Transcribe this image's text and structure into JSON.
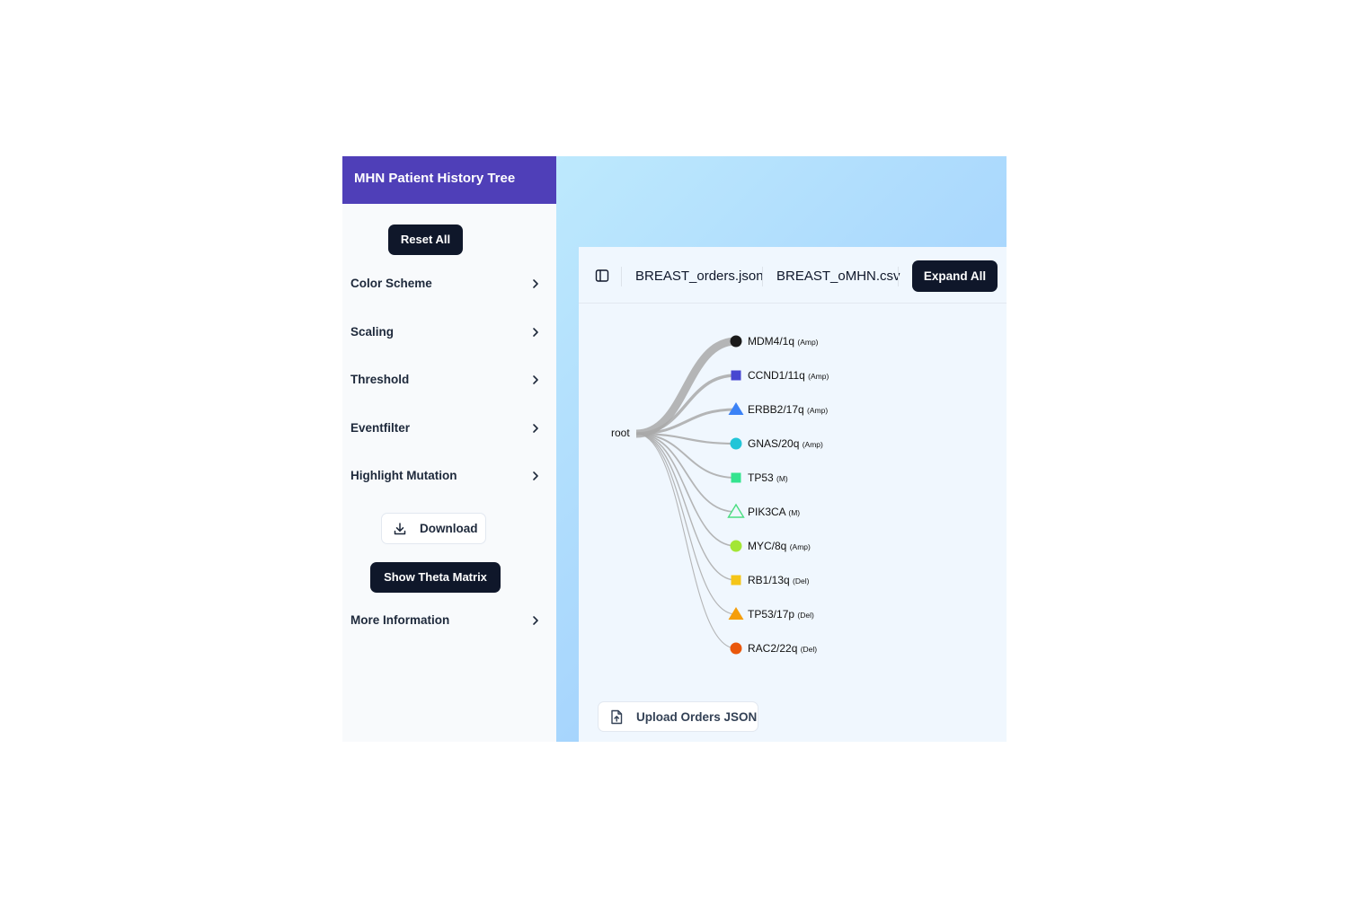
{
  "sidebar": {
    "title": "MHN Patient History Tree",
    "reset_label": "Reset All",
    "accordions": [
      {
        "label": "Color Scheme"
      },
      {
        "label": "Scaling"
      },
      {
        "label": "Threshold"
      },
      {
        "label": "Eventfilter"
      },
      {
        "label": "Highlight Mutation"
      }
    ],
    "download_label": "Download",
    "theta_label": "Show Theta Matrix",
    "more_info_label": "More Information"
  },
  "toolbar": {
    "orders_file": "BREAST_orders.json",
    "omhn_file": "BREAST_oMHN.csv",
    "expand_label": "Expand All"
  },
  "tree": {
    "root_label": "root",
    "link_color": "#a9a9a9",
    "nodes": [
      {
        "label": "MDM4/1q",
        "type": "(Amp)",
        "shape": "circle",
        "color": "#1a1a1a",
        "weight": 9
      },
      {
        "label": "CCND1/11q",
        "type": "(Amp)",
        "shape": "square",
        "color": "#4747d1",
        "weight": 3.5
      },
      {
        "label": "ERBB2/17q",
        "type": "(Amp)",
        "shape": "triangle",
        "color": "#3b82f6",
        "weight": 3
      },
      {
        "label": "GNAS/20q",
        "type": "(Amp)",
        "shape": "circle",
        "color": "#22c5d8",
        "weight": 2.2
      },
      {
        "label": "TP53",
        "type": "(M)",
        "shape": "square",
        "color": "#34e48f",
        "weight": 2
      },
      {
        "label": "PIK3CA",
        "type": "(M)",
        "shape": "triangle-outline",
        "color": "#4ade80",
        "weight": 1.8
      },
      {
        "label": "MYC/8q",
        "type": "(Amp)",
        "shape": "circle",
        "color": "#a3e635",
        "weight": 1.6
      },
      {
        "label": "RB1/13q",
        "type": "(Del)",
        "shape": "square",
        "color": "#f5c518",
        "weight": 1.4
      },
      {
        "label": "TP53/17p",
        "type": "(Del)",
        "shape": "triangle",
        "color": "#f59e0b",
        "weight": 1.2
      },
      {
        "label": "RAC2/22q",
        "type": "(Del)",
        "shape": "circle",
        "color": "#ea580c",
        "weight": 1.1
      }
    ]
  },
  "upload_label": "Upload Orders JSON",
  "colors": {
    "header": "#4f3fb8",
    "button_dark": "#0f172a",
    "panel": "#f0f7fe",
    "sidebar": "#f8fafc"
  },
  "icons": {
    "panel_toggle": "sidebar-toggle-icon",
    "download": "download-icon",
    "upload": "file-upload-icon",
    "chevron": "chevron-right-icon"
  }
}
